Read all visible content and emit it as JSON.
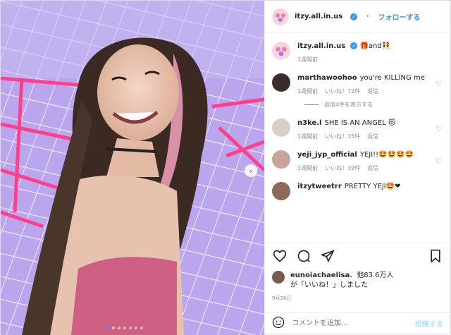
{
  "header": {
    "username": "itzy.all.in.us",
    "separator": "•",
    "follow_label": "フォローする"
  },
  "caption": {
    "username": "itzy.all.in.us",
    "text": "🎁and👯",
    "time": "1週間前"
  },
  "comments": [
    {
      "username": "marthawoohoo",
      "text": "you're KILLING me",
      "time": "1週間前",
      "likes": "いいね！72件",
      "reply": "返信"
    },
    {
      "username": "n3ke.l",
      "text": "SHE IS AN ANGEL 😻",
      "time": "1週間前",
      "likes": "いいね！35件",
      "reply": "返信"
    },
    {
      "username": "yeji_jyp_official",
      "text": "YEJI!!🤩🤩🤩🤩",
      "time": "1週間前",
      "likes": "いいね！39件",
      "reply": "返信"
    },
    {
      "username": "itzytweetrr",
      "text": "PRETTY YEJI🤩❤",
      "time": "",
      "likes": "",
      "reply": ""
    }
  ],
  "view_replies": "返信4件を表示する",
  "likes": {
    "username": "eunoiachaelisa",
    "others": "、他83.6万人",
    "suffix": "が「いいね！」しました"
  },
  "date": "9月26日",
  "add_comment": {
    "placeholder": "コメントを追加...",
    "post_label": "投稿する"
  },
  "colors": {
    "accent": "#3897f0",
    "muted": "#8e8e8e",
    "post_disabled": "#b2dffc"
  },
  "carousel": {
    "count": 7,
    "active_index": 0
  }
}
